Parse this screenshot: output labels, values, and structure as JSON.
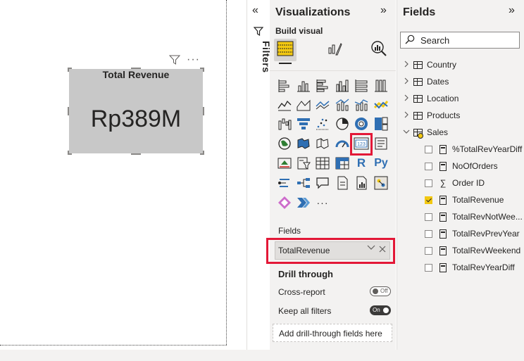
{
  "canvas": {
    "card": {
      "title": "Total Revenue",
      "value": "Rp389M"
    }
  },
  "filters_strip": {
    "label": "Filters",
    "collapse_glyph": "«"
  },
  "visualizations": {
    "title": "Visualizations",
    "collapse_glyph": "»",
    "build_visual_label": "Build visual",
    "tabs": [
      {
        "name": "build-visual",
        "icon": "build-visual-icon",
        "active": true
      },
      {
        "name": "format-visual",
        "icon": "paintbrush-icon"
      },
      {
        "name": "analytics",
        "icon": "magnifier-chart-icon"
      }
    ],
    "gallery": [
      [
        "stacked-bar-chart",
        "stacked-column-chart",
        "clustered-bar-chart",
        "clustered-column-chart",
        "100-stacked-bar-chart",
        "100-stacked-column-chart"
      ],
      [
        "line-chart",
        "area-chart",
        "stacked-area-chart",
        "line-and-stacked-column-chart",
        "line-and-clustered-column-chart",
        "ribbon-chart"
      ],
      [
        "waterfall-chart",
        "funnel-chart",
        "scatter-chart",
        "pie-chart",
        "donut-chart",
        "treemap"
      ],
      [
        "map",
        "filled-map",
        "shape-map",
        "gauge",
        "card",
        "multi-row-card"
      ],
      [
        "kpi",
        "slicer",
        "table",
        "matrix",
        "r-script-visual",
        "python-visual"
      ],
      [
        "key-influencers",
        "decomposition-tree",
        "qa-visual",
        "smart-narrative",
        "paginated-report",
        "arcgis-map"
      ],
      [
        "power-apps",
        "power-automate",
        "more-visuals"
      ]
    ],
    "gallery_text": {
      "r": "R",
      "py": "Py",
      "more": "···",
      "card": "123"
    },
    "fields_label": "Fields",
    "field_well_value": "TotalRevenue",
    "drill_through": {
      "title": "Drill through",
      "cross_report_label": "Cross-report",
      "cross_report_state": "Off",
      "keep_filters_label": "Keep all filters",
      "keep_filters_state": "On",
      "add_fields_label": "Add drill-through fields here"
    }
  },
  "fields": {
    "title": "Fields",
    "collapse_glyph": "»",
    "search_placeholder": "Search",
    "tables": [
      {
        "name": "Country",
        "expanded": false
      },
      {
        "name": "Dates",
        "expanded": false
      },
      {
        "name": "Location",
        "expanded": false
      },
      {
        "name": "Products",
        "expanded": false
      },
      {
        "name": "Sales",
        "expanded": true
      }
    ],
    "sales_fields": [
      {
        "name": "%TotalRevYearDiff",
        "kind": "measure",
        "checked": false
      },
      {
        "name": "NoOfOrders",
        "kind": "measure",
        "checked": false
      },
      {
        "name": "Order ID",
        "kind": "sum",
        "checked": false
      },
      {
        "name": "TotalRevenue",
        "kind": "measure",
        "checked": true
      },
      {
        "name": "TotalRevNotWee...",
        "kind": "measure",
        "checked": false
      },
      {
        "name": "TotalRevPrevYear",
        "kind": "measure",
        "checked": false
      },
      {
        "name": "TotalRevWeekend",
        "kind": "measure",
        "checked": false
      },
      {
        "name": "TotalRevYearDiff",
        "kind": "measure",
        "checked": false
      }
    ]
  },
  "colors": {
    "highlight": "#e31837",
    "accent": "#f2c811",
    "card_bg": "#c8c8c8",
    "pane_bg": "#f3f2f1"
  }
}
